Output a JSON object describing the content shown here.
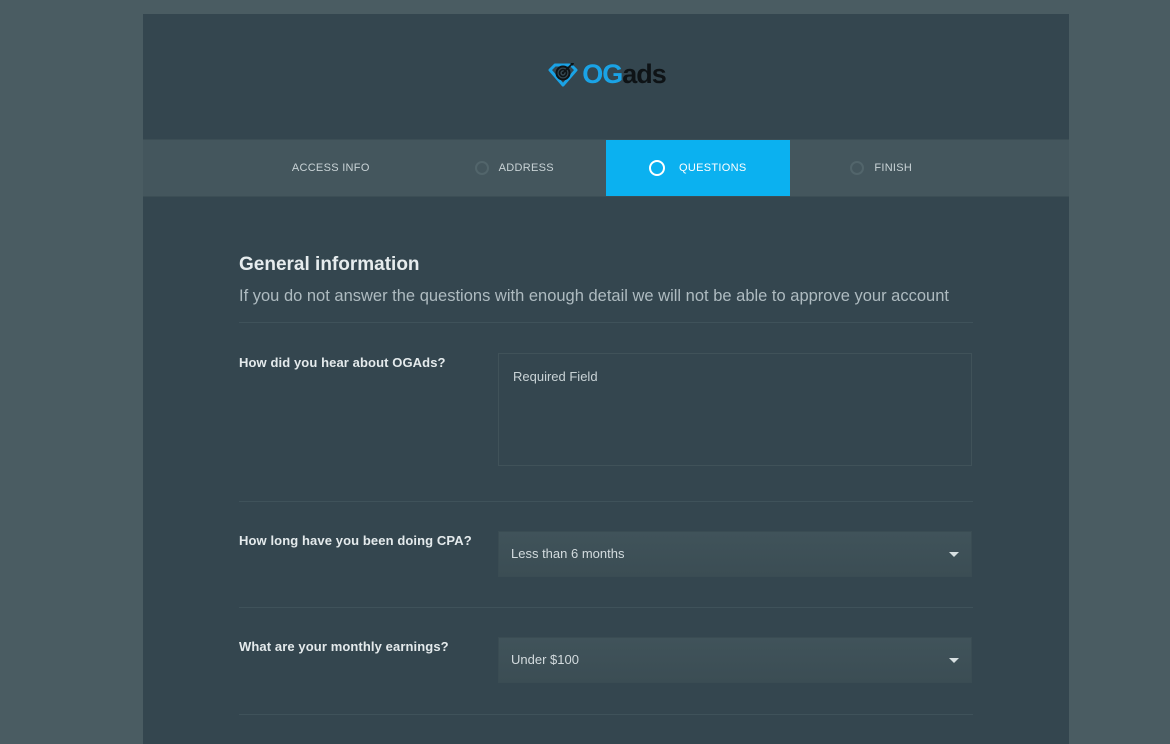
{
  "brand": {
    "logo_og": "OG",
    "logo_ads": "ads",
    "accent_color": "#0bb1f0"
  },
  "steps": [
    {
      "label": "ACCESS INFO",
      "active": false
    },
    {
      "label": "ADDRESS",
      "active": false
    },
    {
      "label": "QUESTIONS",
      "active": true
    },
    {
      "label": "FINISH",
      "active": false
    }
  ],
  "section": {
    "title": "General information",
    "subtitle": "If you do not answer the questions with enough detail we will not be able to approve your account"
  },
  "questions": {
    "heard_about": {
      "label": "How did you hear about OGAds?",
      "placeholder": "Required Field",
      "value": ""
    },
    "cpa_duration": {
      "label": "How long have you been doing CPA?",
      "selected": "Less than 6 months"
    },
    "monthly_earnings": {
      "label": "What are your monthly earnings?",
      "selected": "Under $100"
    }
  }
}
